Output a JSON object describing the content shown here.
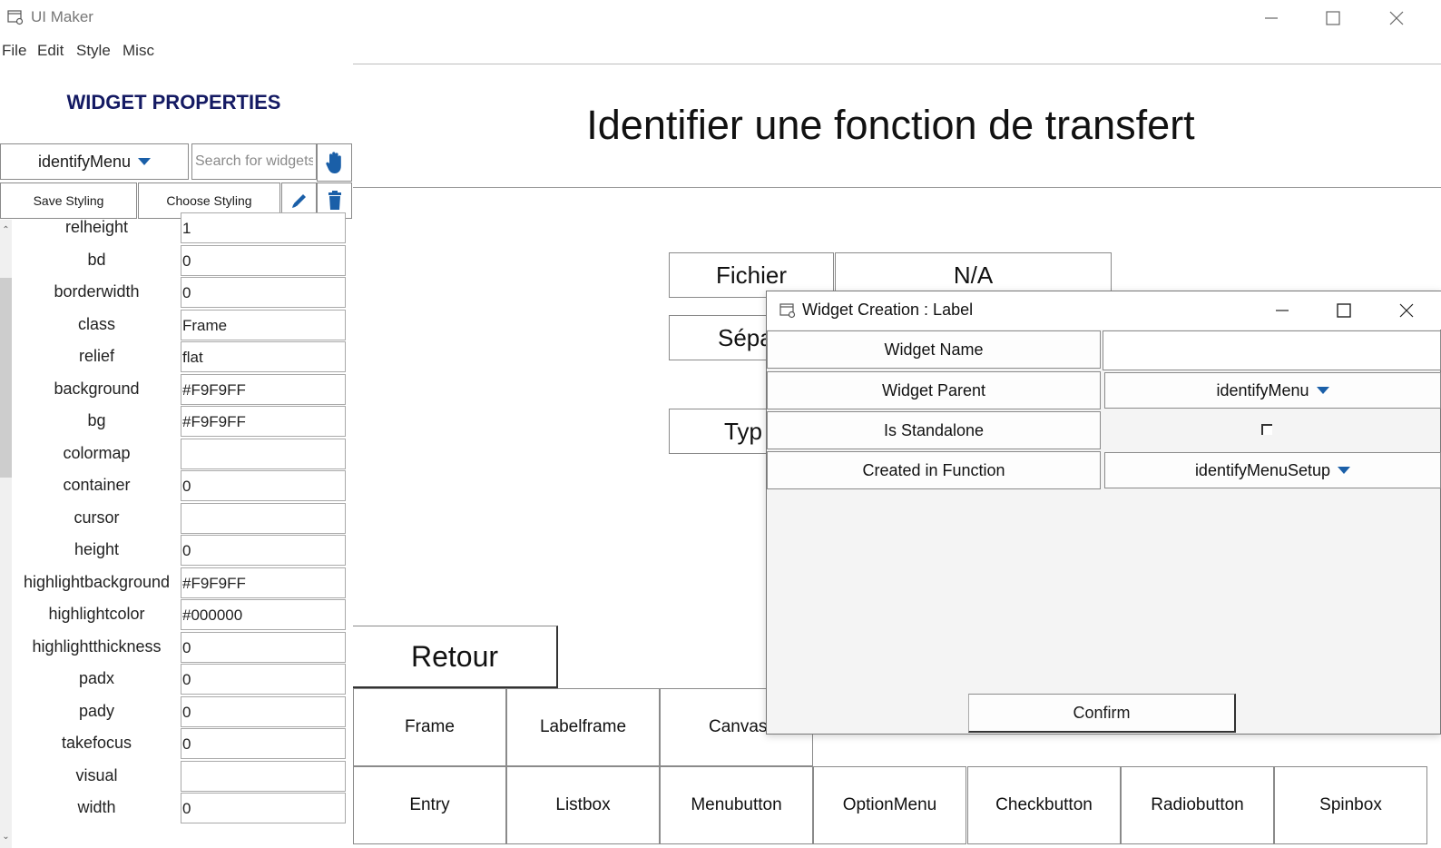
{
  "window": {
    "title": "UI Maker",
    "controls": [
      "minimize-icon",
      "maximize-icon",
      "close-icon"
    ]
  },
  "menubar": {
    "items": [
      "File",
      "Edit",
      "Style",
      "Misc"
    ]
  },
  "left_panel": {
    "title": "WIDGET PROPERTIES",
    "widget_select": {
      "value": "identifyMenu"
    },
    "search": {
      "placeholder": "Search for widgets",
      "value": ""
    },
    "buttons": {
      "save_styling": "Save Styling",
      "choose_styling": "Choose Styling"
    },
    "icons": {
      "hand": "hand-icon",
      "edit": "pencil-icon",
      "delete": "trash-icon"
    },
    "properties": [
      {
        "name": "relheight",
        "value": "1"
      },
      {
        "name": "bd",
        "value": "0"
      },
      {
        "name": "borderwidth",
        "value": "0"
      },
      {
        "name": "class",
        "value": "Frame"
      },
      {
        "name": "relief",
        "value": "flat"
      },
      {
        "name": "background",
        "value": "#F9F9FF"
      },
      {
        "name": "bg",
        "value": "#F9F9FF"
      },
      {
        "name": "colormap",
        "value": ""
      },
      {
        "name": "container",
        "value": "0"
      },
      {
        "name": "cursor",
        "value": ""
      },
      {
        "name": "height",
        "value": "0"
      },
      {
        "name": "highlightbackground",
        "value": "#F9F9FF"
      },
      {
        "name": "highlightcolor",
        "value": "#000000"
      },
      {
        "name": "highlightthickness",
        "value": "0"
      },
      {
        "name": "padx",
        "value": "0"
      },
      {
        "name": "pady",
        "value": "0"
      },
      {
        "name": "takefocus",
        "value": "0"
      },
      {
        "name": "visual",
        "value": ""
      },
      {
        "name": "width",
        "value": "0"
      }
    ]
  },
  "canvas": {
    "title": "Identifier une fonction de transfert",
    "labels": {
      "fichier": "Fichier",
      "na": "N/A",
      "separator_partial": "Sépa",
      "type_partial": "Typ"
    },
    "retour_button": "Retour",
    "palette_row1": [
      "Frame",
      "Labelframe",
      "Canvas"
    ],
    "palette_row2": [
      "Entry",
      "Listbox",
      "Menubutton",
      "OptionMenu",
      "Checkbutton",
      "Radiobutton",
      "Spinbox"
    ]
  },
  "dialog": {
    "title": "Widget Creation : Label",
    "fields": {
      "widget_name_label": "Widget Name",
      "widget_name_value": "",
      "widget_parent_label": "Widget Parent",
      "widget_parent_value": "identifyMenu",
      "is_standalone_label": "Is Standalone",
      "is_standalone_checked": false,
      "created_in_function_label": "Created in Function",
      "created_in_function_value": "identifyMenuSetup"
    },
    "confirm_button": "Confirm"
  },
  "colors": {
    "accent_blue": "#1a5fa8",
    "panel_title": "#141a63",
    "widget_bg": "#F9F9FF"
  }
}
